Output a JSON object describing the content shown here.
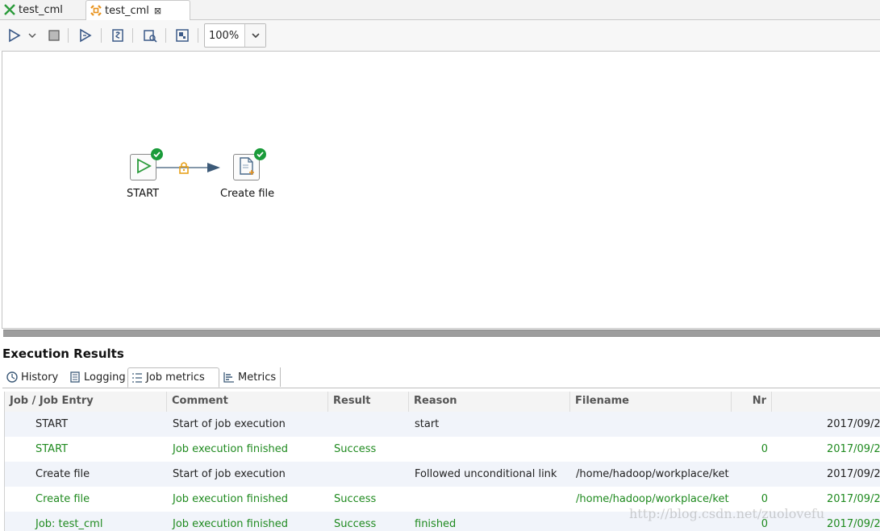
{
  "tabs": [
    {
      "label": "test_cml",
      "icon": "transformation-icon"
    },
    {
      "label": "test_cml",
      "icon": "job-icon",
      "close": "⊠"
    }
  ],
  "toolbar": {
    "icons": [
      "run-icon",
      "run-dropdown-icon",
      "stop-icon",
      "replay-icon",
      "sql-icon",
      "analyze-icon",
      "layout-icon"
    ],
    "zoom_value": "100%"
  },
  "canvas": {
    "nodes": [
      {
        "label": "START",
        "icon": "start-icon",
        "status": "success"
      },
      {
        "label": "Create file",
        "icon": "create-file-icon",
        "status": "success"
      }
    ],
    "hop": {
      "icon": "lock-icon",
      "type": "unconditional"
    }
  },
  "results": {
    "title": "Execution Results",
    "tabs": [
      {
        "label": "History",
        "icon": "history-icon"
      },
      {
        "label": "Logging",
        "icon": "logging-icon"
      },
      {
        "label": "Job metrics",
        "icon": "job-metrics-icon",
        "active": true
      },
      {
        "label": "Metrics",
        "icon": "metrics-icon"
      }
    ],
    "columns": [
      "Job / Job Entry",
      "Comment",
      "Result",
      "Reason",
      "Filename",
      "Nr",
      ""
    ],
    "rows": [
      {
        "entry": "START",
        "comment": "Start of job execution",
        "result": "",
        "reason": "start",
        "filename": "",
        "nr": "",
        "date": "2017/09/2",
        "color": "black"
      },
      {
        "entry": "START",
        "comment": "Job execution finished",
        "result": "Success",
        "reason": "",
        "filename": "",
        "nr": "0",
        "date": "2017/09/2",
        "color": "green"
      },
      {
        "entry": "Create file",
        "comment": "Start of job execution",
        "result": "",
        "reason": "Followed unconditional link",
        "filename": "/home/hadoop/workplace/ket",
        "nr": "",
        "date": "2017/09/2",
        "color": "black"
      },
      {
        "entry": "Create file",
        "comment": "Job execution finished",
        "result": "Success",
        "reason": "",
        "filename": "/home/hadoop/workplace/ket",
        "nr": "0",
        "date": "2017/09/2",
        "color": "green"
      },
      {
        "entry": "Job: test_cml",
        "comment": "Job execution finished",
        "result": "Success",
        "reason": "finished",
        "filename": "",
        "nr": "0",
        "date": "2017/09/2",
        "color": "green"
      }
    ]
  },
  "watermark": "http://blog.csdn.net/zuolovefu"
}
